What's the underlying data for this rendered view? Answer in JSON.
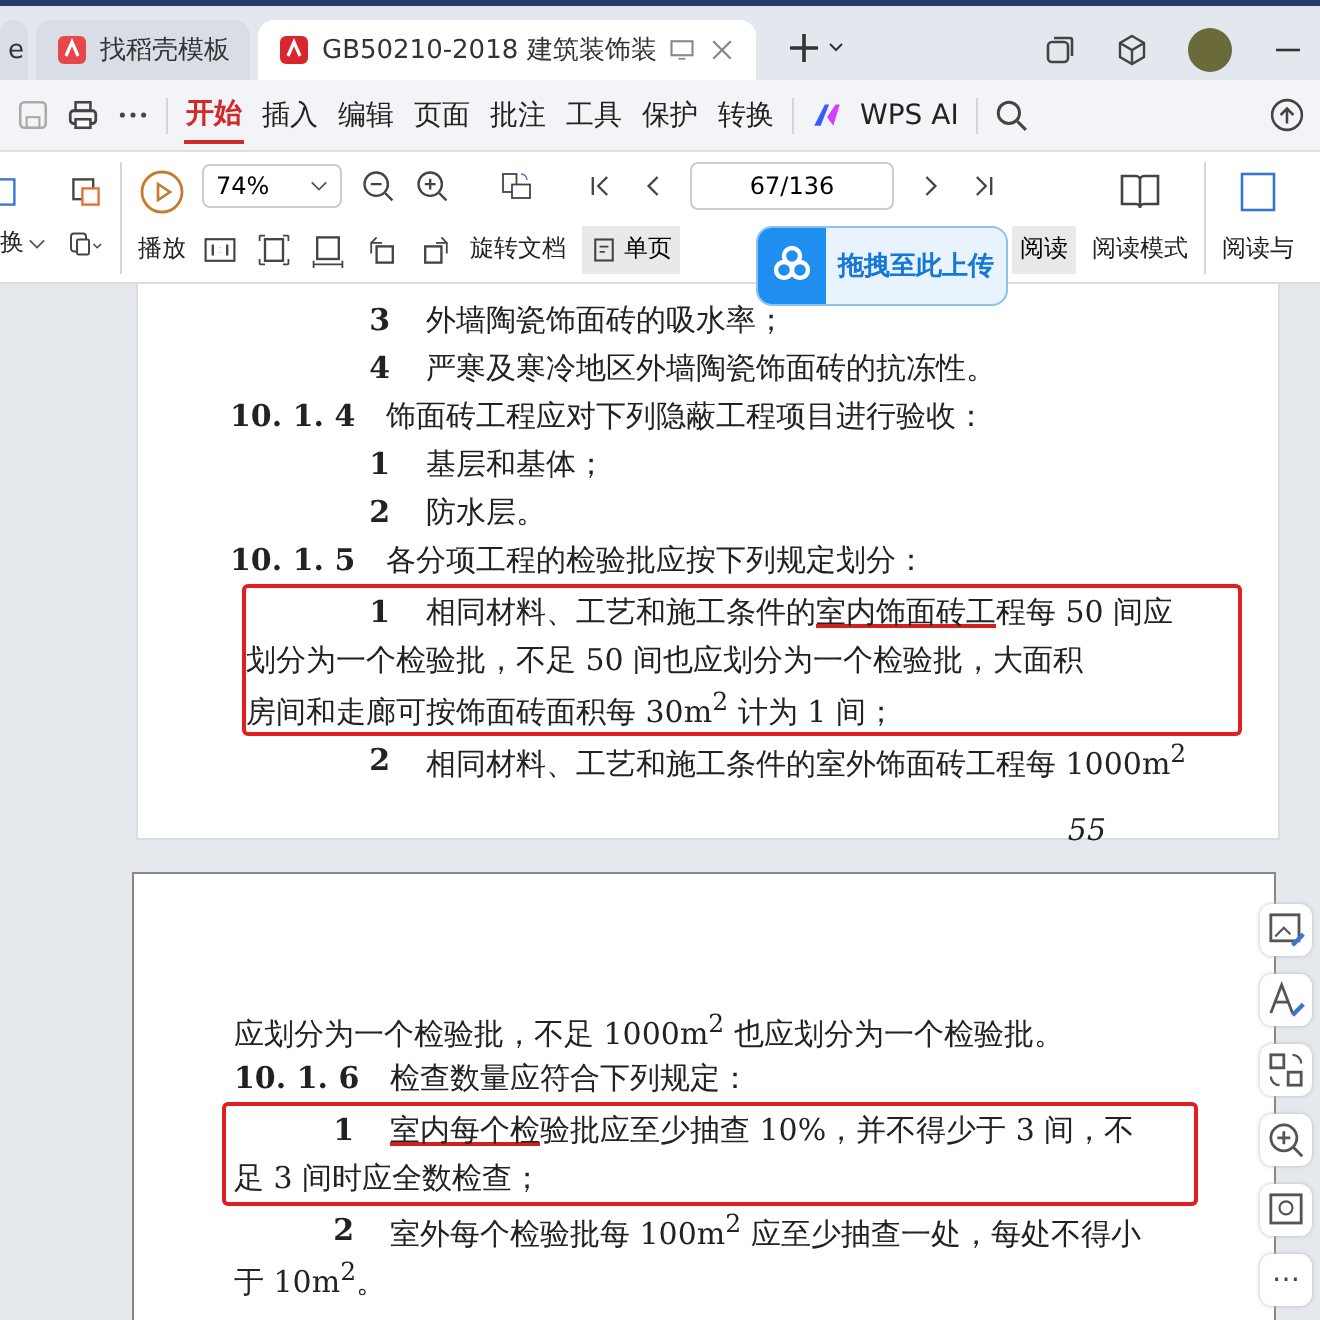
{
  "tabs": [
    {
      "label": "e",
      "selected": false
    },
    {
      "label": "找稻壳模板",
      "selected": false
    },
    {
      "label": "GB50210-2018 建筑装饰装",
      "selected": true
    }
  ],
  "menu": [
    {
      "label": "开始",
      "selected": true
    },
    {
      "label": "插入",
      "selected": false
    },
    {
      "label": "编辑",
      "selected": false
    },
    {
      "label": "页面",
      "selected": false
    },
    {
      "label": "批注",
      "selected": false
    },
    {
      "label": "工具",
      "selected": false
    },
    {
      "label": "保护",
      "selected": false
    },
    {
      "label": "转换",
      "selected": false
    }
  ],
  "ai_label": "WPS AI",
  "toolbar": {
    "convert": "换",
    "play": "播放",
    "zoom": "74%",
    "rotate": "旋转文档",
    "single_page": "单页",
    "page": "67/136",
    "read": "阅读",
    "read_mode": "阅读模式",
    "read_with": "阅读与"
  },
  "upload_bubble": "拖拽至此上传",
  "pages": [
    {
      "page_number": "55",
      "blocks": [
        {
          "boxed": false,
          "lines": [
            {
              "kind": "item",
              "num": "3",
              "segments": [
                {
                  "text": "外墙陶瓷饰面砖的吸水率；",
                  "underline": false
                }
              ]
            },
            {
              "kind": "item",
              "num": "4",
              "segments": [
                {
                  "text": "严寒及寒冷地区外墙陶瓷饰面砖的抗冻性。",
                  "underline": false
                }
              ]
            },
            {
              "kind": "clause",
              "num": "10. 1. 4",
              "segments": [
                {
                  "text": "饰面砖工程应对下列隐蔽工程项目进行验收：",
                  "underline": false
                }
              ]
            },
            {
              "kind": "item",
              "num": "1",
              "segments": [
                {
                  "text": "基层和基体；",
                  "underline": false
                }
              ]
            },
            {
              "kind": "item",
              "num": "2",
              "segments": [
                {
                  "text": "防水层。",
                  "underline": false
                }
              ]
            },
            {
              "kind": "clause",
              "num": "10. 1. 5",
              "segments": [
                {
                  "text": "各分项工程的检验批应按下列规定划分：",
                  "underline": false
                }
              ]
            }
          ]
        },
        {
          "boxed": true,
          "lines": [
            {
              "kind": "item",
              "num": "1",
              "segments": [
                {
                  "text": "相同材料、工艺和施工条件的",
                  "underline": false
                },
                {
                  "text": "室内饰面砖工",
                  "underline": true
                },
                {
                  "text": "程每 50 间应",
                  "underline": false
                }
              ]
            },
            {
              "kind": "cont",
              "segments": [
                {
                  "text": "划分为一个检验批，不足 50 间也应划分为一个检验批，大面积",
                  "underline": false
                }
              ]
            },
            {
              "kind": "cont",
              "segments": [
                {
                  "text": "房间和走廊可按饰面砖面积每 30m$^{2}$ 计为 1 间；",
                  "underline": false
                }
              ]
            }
          ]
        },
        {
          "boxed": false,
          "lines": [
            {
              "kind": "item",
              "num": "2",
              "segments": [
                {
                  "text": "相同材料、工艺和施工条件的室外饰面砖工程每 1000m$^{2}$",
                  "underline": false
                }
              ]
            }
          ]
        }
      ]
    },
    {
      "blocks": [
        {
          "boxed": false,
          "lines": [
            {
              "kind": "cont",
              "segments": [
                {
                  "text": "应划分为一个检验批，不足 1000m$^{2}$ 也应划分为一个检验批。",
                  "underline": false
                }
              ]
            },
            {
              "kind": "clause",
              "num": "10. 1. 6",
              "segments": [
                {
                  "text": "检查数量应符合下列规定：",
                  "underline": false
                }
              ]
            }
          ]
        },
        {
          "boxed": true,
          "lines": [
            {
              "kind": "item",
              "num": "1",
              "segments": [
                {
                  "text": "室内每个检",
                  "underline": true
                },
                {
                  "text": "验批应至少抽查 10%，并不得少于 3 间，不",
                  "underline": false
                }
              ]
            },
            {
              "kind": "cont",
              "segments": [
                {
                  "text": "足 3 间时应全数检查；",
                  "underline": false
                }
              ]
            }
          ]
        },
        {
          "boxed": false,
          "lines": [
            {
              "kind": "item",
              "num": "2",
              "segments": [
                {
                  "text": "室外每个检验批每 100m$^{2}$ 应至少抽查一处，每处不得小",
                  "underline": false
                }
              ]
            },
            {
              "kind": "cont",
              "segments": [
                {
                  "text": "于 10m$^{2}$。",
                  "underline": false
                }
              ]
            }
          ]
        }
      ]
    }
  ],
  "side_more": "⋯"
}
